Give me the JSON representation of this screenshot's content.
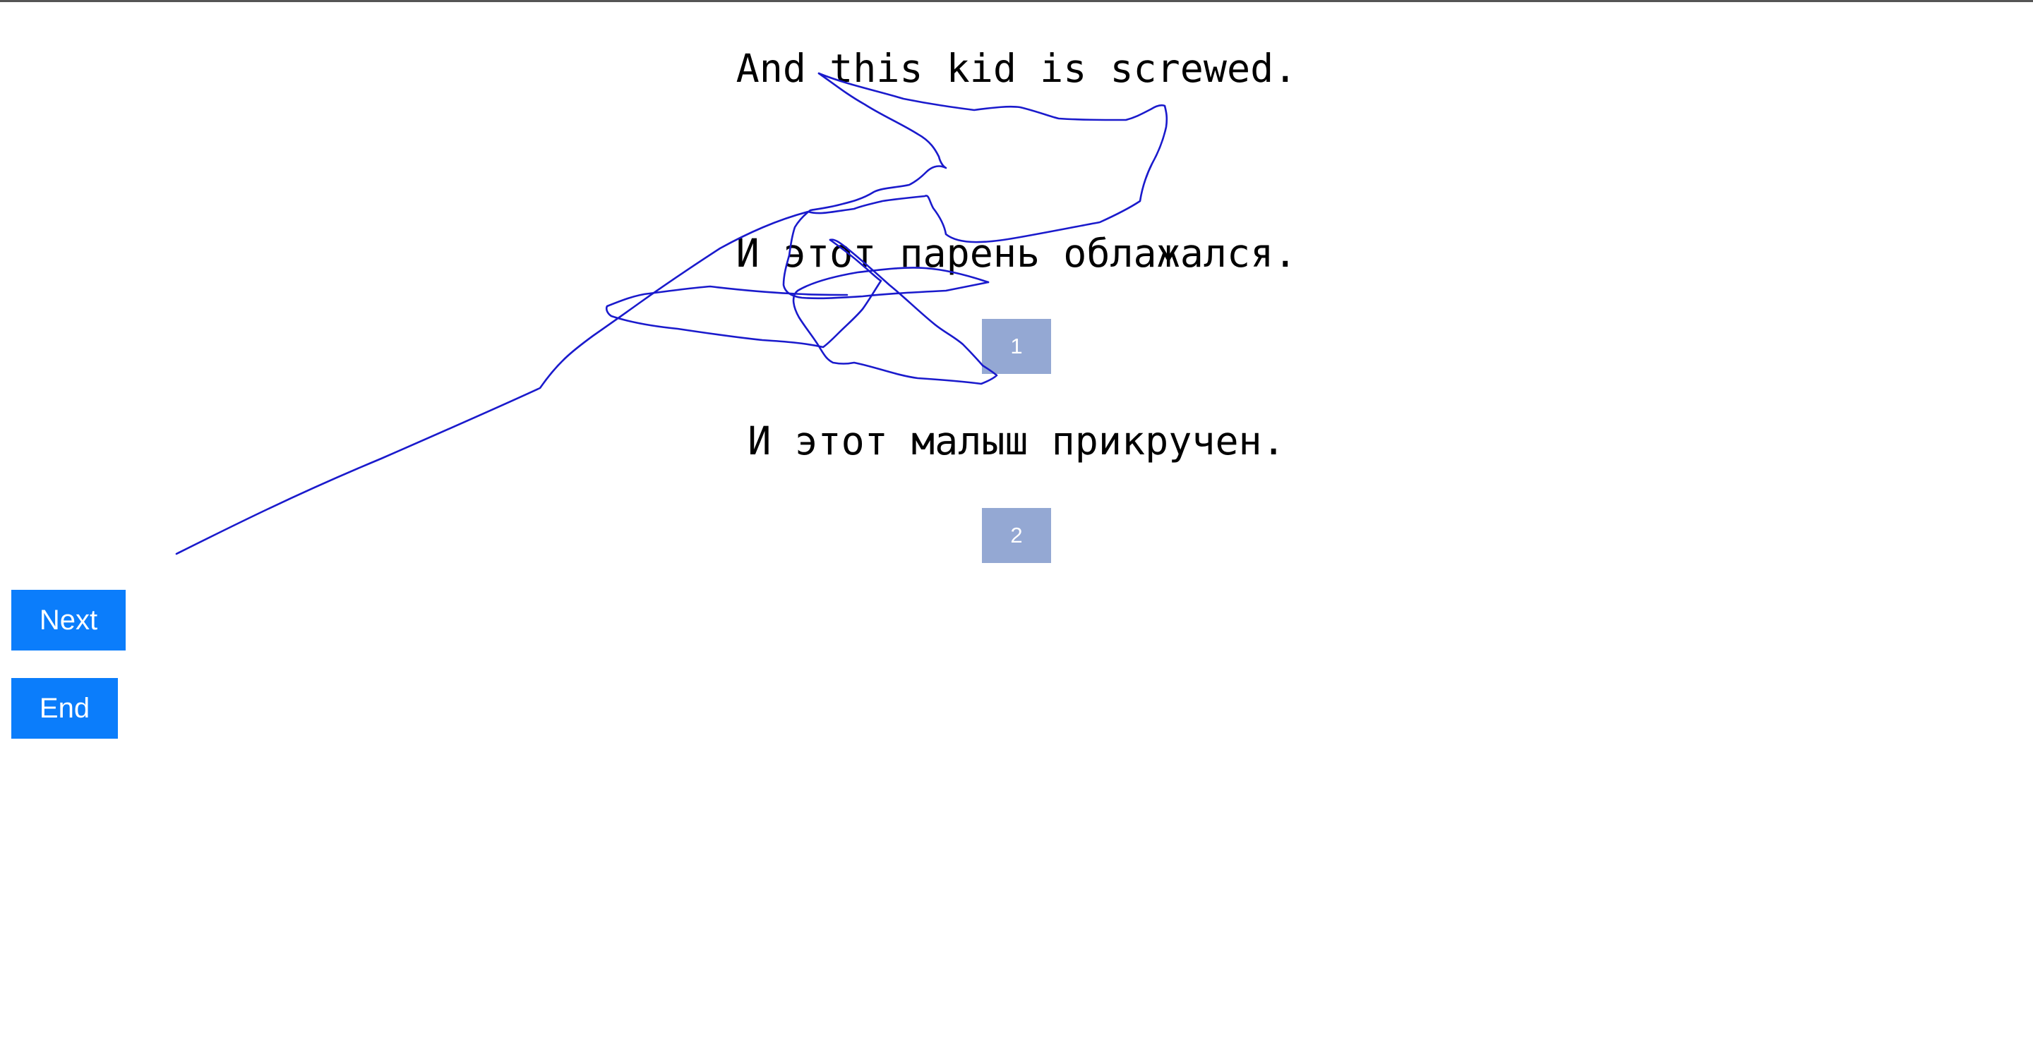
{
  "source_sentence": "And this kid is screwed.",
  "options": [
    {
      "text": "И этот парень облажался.",
      "button_label": "1"
    },
    {
      "text": "И этот малыш прикручен.",
      "button_label": "2"
    }
  ],
  "navigation": {
    "next_label": "Next",
    "end_label": "End"
  },
  "colors": {
    "choice_button": "#94a8d3",
    "nav_button": "#0b7dfb",
    "ink_stroke": "#1a1acc"
  }
}
